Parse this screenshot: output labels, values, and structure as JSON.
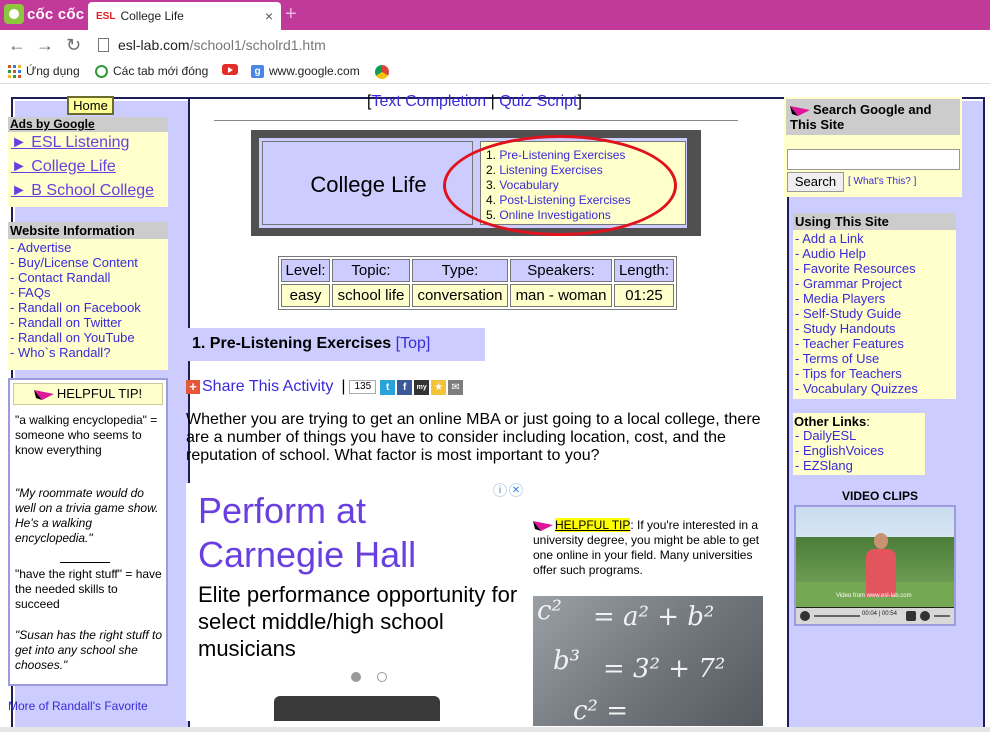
{
  "browser": {
    "brand": "cốc cốc",
    "tab_favicon": "ESL",
    "tab_title": "College Life",
    "tab_close": "×",
    "new_tab": "+",
    "back": "←",
    "forward": "→",
    "reload": "↻",
    "url_host": "esl-lab.com",
    "url_path": "/school1/scholrd1.htm"
  },
  "bookmarks": [
    {
      "label": "Ứng dụng",
      "icon": "apps-grid-icon"
    },
    {
      "label": "Các tab mới đóng",
      "icon": "history-icon"
    },
    {
      "label": "",
      "icon": "youtube-icon"
    },
    {
      "label": "www.google.com",
      "icon": "google-icon"
    },
    {
      "label": "",
      "icon": "chrome-icon"
    }
  ],
  "left": {
    "home": "Home",
    "ads_title": "Ads by Google",
    "ads": [
      "► ESL Listening",
      "► College Life",
      "► B School College"
    ],
    "info_title": "Website Information",
    "info_items": [
      "- Advertise",
      "- Buy/License Content",
      "- Contact Randall",
      "- FAQs",
      "- Randall on Facebook",
      "- Randall on Twitter",
      "- Randall on YouTube",
      "- Who`s Randall?"
    ],
    "tip_title": "HELPFUL TIP!",
    "tip_1": "\"a walking encyclopedia\" = someone who seems to know everything",
    "tip_1_example": "\"My roommate would do well on a trivia game show. He's a walking encyclopedia.\"",
    "tip_2": "\"have the right stuff\" = have the needed skills to succeed",
    "tip_2_example": "\"Susan has the right stuff to get into any school she chooses.\"",
    "more": "More of Randall's Favorite"
  },
  "center": {
    "top_links": {
      "open": "[",
      "text_completion": "Text Completion",
      "sep": " | ",
      "quiz_script": "Quiz Script",
      "close": "]"
    },
    "title": "College Life",
    "exercises": [
      {
        "num": "1. ",
        "label": "Pre-Listening Exercises"
      },
      {
        "num": "2. ",
        "label": "Listening Exercises"
      },
      {
        "num": "3. ",
        "label": "Vocabulary"
      },
      {
        "num": "4. ",
        "label": "Post-Listening Exercises"
      },
      {
        "num": "5. ",
        "label": "Online Investigations"
      }
    ],
    "table": {
      "headers": [
        "Level:",
        "Topic:",
        "Type:",
        "Speakers:",
        "Length:"
      ],
      "values": [
        "easy",
        "school life",
        "conversation",
        "man - woman",
        "01:25"
      ]
    },
    "section_title": "1. Pre-Listening Exercises ",
    "section_top": "[Top]",
    "share_label": "Share This Activity",
    "share_sep": "|",
    "share_count": "135",
    "intro": "Whether you are trying to get an online MBA or just going to a local college, there are a number of things you have to consider including location, cost, and the reputation of school. What factor is most important to you?",
    "ad": {
      "title": "Perform at Carnegie Hall",
      "body": "Elite performance opportunity for select middle/high school musicians",
      "dots": 2,
      "active_dot": 0
    },
    "tip2_label": "HELPFUL TIP",
    "tip2_text": ": If you're interested in a university degree, you might be able to get one online in your field. Many universities offer such programs."
  },
  "right": {
    "search_title": "Search Google and This Site",
    "search_value": "",
    "search_button": "Search",
    "whats_this": "[ What's This? ]",
    "using_title": "Using This Site",
    "using_items": [
      "- Add a Link",
      "- Audio Help",
      "- Favorite Resources",
      "- Grammar Project",
      "- Media Players",
      "- Self-Study Guide",
      "- Study Handouts",
      "- Teacher Features",
      "- Terms of Use",
      "- Tips for Teachers",
      "- Vocabulary Quizzes"
    ],
    "other_title": "Other Links",
    "other_colon": ":",
    "other_items": [
      "- DailyESL",
      "- EnglishVoices",
      "- EZSlang"
    ],
    "video_title": "VIDEO CLIPS",
    "video_caption": "Video from www.esl-lab.com",
    "video_time": "00:04 | 00:54"
  },
  "colors": {
    "tabstrip": "#c13a9a",
    "panel_lavender": "#ccccff",
    "panel_yellow": "#ffffcc",
    "link": "#3a2ad8",
    "annotation_circle": "#e0131d"
  }
}
